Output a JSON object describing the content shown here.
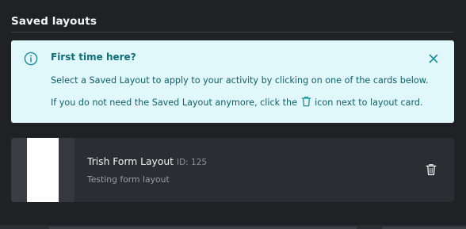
{
  "section": {
    "title": "Saved layouts"
  },
  "banner": {
    "heading": "First time here?",
    "line1": "Select a Saved Layout to apply to your activity by clicking on one of the cards below.",
    "line2_before": "If you do not need the Saved Layout anymore, click the",
    "line2_after": "icon next to layout card.",
    "icons": {
      "info": "info-icon",
      "close": "close-icon",
      "inline": "trash-icon"
    }
  },
  "layouts": [
    {
      "name": "Trish Form Layout",
      "id_label": "ID: 125",
      "description": "Testing form layout",
      "delete_icon": "trash-icon"
    }
  ],
  "colors": {
    "background": "#1f2125",
    "banner_bg": "#e0f7fc",
    "banner_text": "#0f5f6a",
    "card_bg": "#2a2d31"
  }
}
